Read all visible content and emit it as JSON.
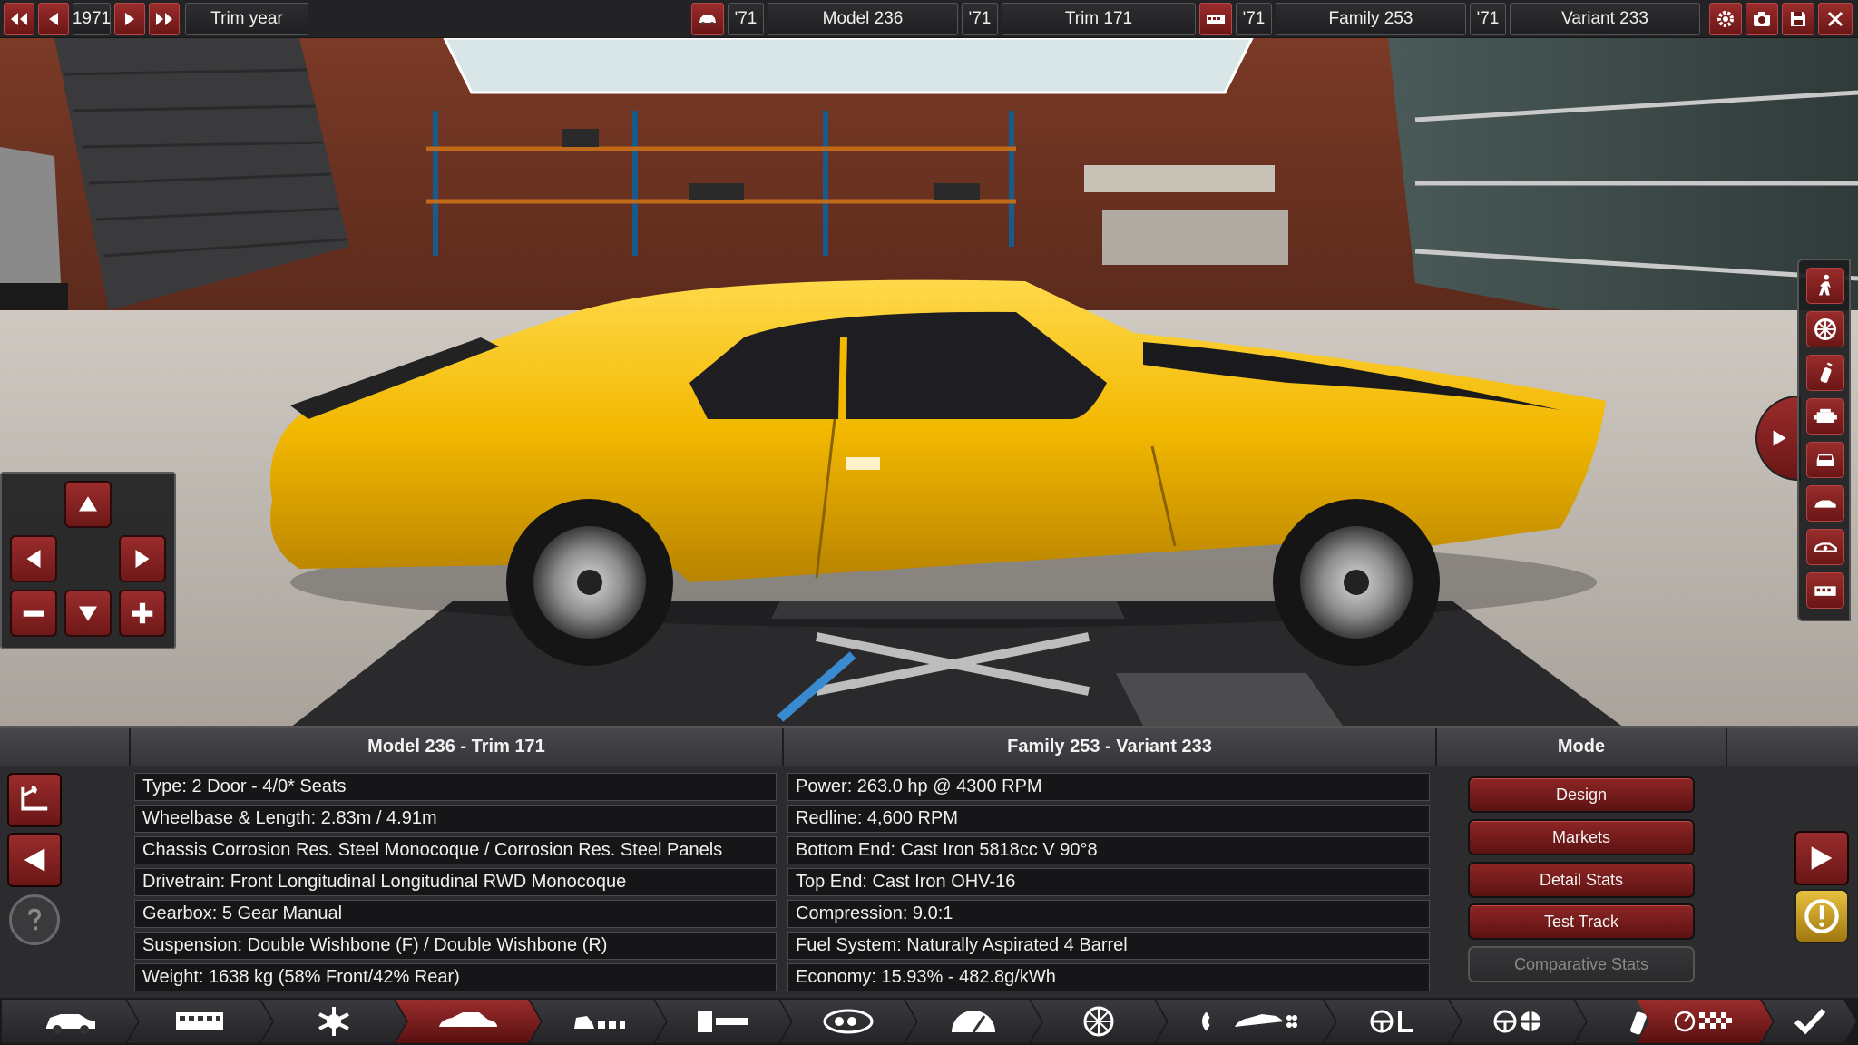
{
  "topbar": {
    "year": "1971",
    "trim_year_label": "Trim year",
    "model_year": "'71",
    "model_name": "Model 236",
    "trim_year": "'71",
    "trim_name": "Trim 171",
    "family_year": "'71",
    "family_name": "Family 253",
    "variant_year": "'71",
    "variant_name": "Variant 233"
  },
  "car": {
    "body_color": "#f2b800"
  },
  "panel": {
    "model_header": "Model 236 - Trim 171",
    "family_header": "Family 253 - Variant 233",
    "mode_header": "Mode",
    "model_stats": [
      "Type: 2 Door - 4/0* Seats",
      "Wheelbase & Length: 2.83m / 4.91m",
      "Chassis Corrosion Res. Steel Monocoque / Corrosion Res. Steel Panels",
      "Drivetrain: Front Longitudinal Longitudinal RWD Monocoque",
      "Gearbox: 5 Gear Manual",
      "Suspension: Double Wishbone (F) / Double Wishbone (R)",
      "Weight: 1638 kg (58% Front/42% Rear)"
    ],
    "engine_stats": [
      "Power: 263.0 hp @ 4300 RPM",
      "Redline:  4,600 RPM",
      "Bottom End: Cast Iron 5818cc V 90°8",
      "Top End: Cast Iron OHV-16",
      "Compression: 9.0:1",
      "Fuel System: Naturally Aspirated 4 Barrel",
      "Economy: 15.93% - 482.8g/kWh"
    ],
    "modes": [
      "Design",
      "Markets",
      "Detail Stats",
      "Test Track",
      "Comparative Stats"
    ]
  },
  "colors": {
    "accent_red": "#8e2525",
    "panel_bg": "#2c2c2f",
    "row_bg": "#161618"
  }
}
